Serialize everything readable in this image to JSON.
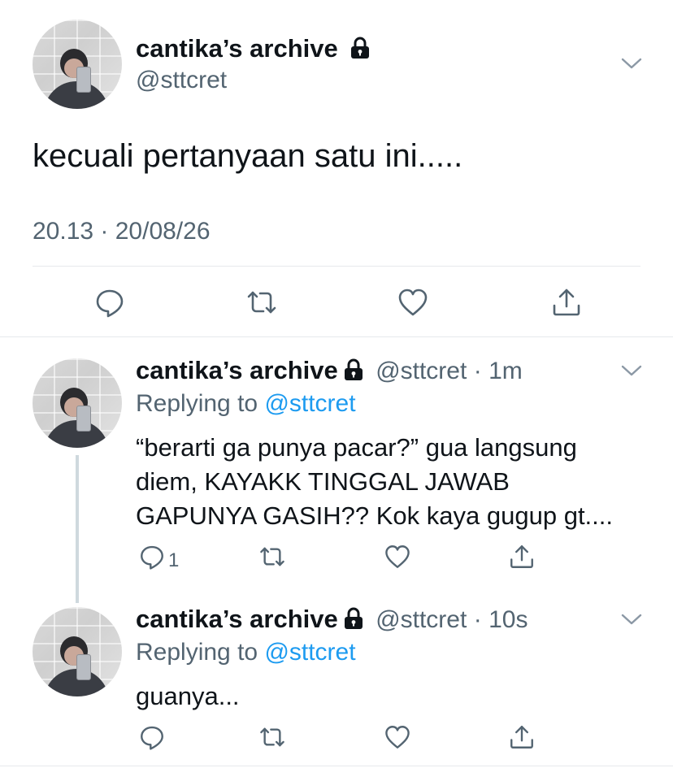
{
  "main_tweet": {
    "display_name": "cantika’s archive",
    "handle": "@sttcret",
    "text": "kecuali pertanyaan satu ini.....",
    "timestamp": "20.13 · 20/08/26",
    "icons": [
      "reply-icon",
      "retweet-icon",
      "like-icon",
      "share-icon"
    ]
  },
  "replies": [
    {
      "display_name": "cantika’s archive",
      "handle": "@sttcret",
      "age": "· 1m",
      "replying_to_label": "Replying to",
      "replying_to_handle": "@sttcret",
      "lines": [
        "“berarti ga punya pacar?” gua langsung",
        "diem, KAYAKK TINGGAL JAWAB",
        "GAPUNYA GASIH?? Kok kaya gugup gt...."
      ],
      "reply_count": "1"
    },
    {
      "display_name": "cantika’s archive",
      "handle": "@sttcret",
      "age": "· 10s",
      "replying_to_label": "Replying to",
      "replying_to_handle": "@sttcret",
      "lines": [
        "guanya..."
      ],
      "reply_count": ""
    }
  ],
  "colors": {
    "text": "#0f1419",
    "secondary": "#536471",
    "link": "#1d9bf0",
    "divider": "#e6e9ec"
  }
}
